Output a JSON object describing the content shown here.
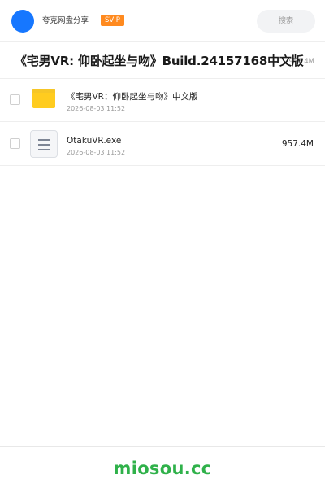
{
  "header": {
    "sharer_name": "夸克网盘分享",
    "vip_badge": "SVIP",
    "search_label": "搜索"
  },
  "share": {
    "title": "《宅男VR: 仰卧起坐与吻》Build.24157168中文版",
    "total_size": "957.4M"
  },
  "files": [
    {
      "name": "《宅男VR：仰卧起坐与吻》中文版",
      "date": "2026-08-03 11:52",
      "size": "",
      "icon": "folder-icon"
    },
    {
      "name": "OtakuVR.exe",
      "date": "2026-08-03 11:52",
      "size": "957.4M",
      "icon": "file-doc-icon"
    }
  ],
  "footer": {
    "watermark": "miosou.cc"
  },
  "colors": {
    "avatar": "#1677ff",
    "svip": "#ff8a1f",
    "folder": "#ffcc1f",
    "watermark": "#2fb14a"
  }
}
